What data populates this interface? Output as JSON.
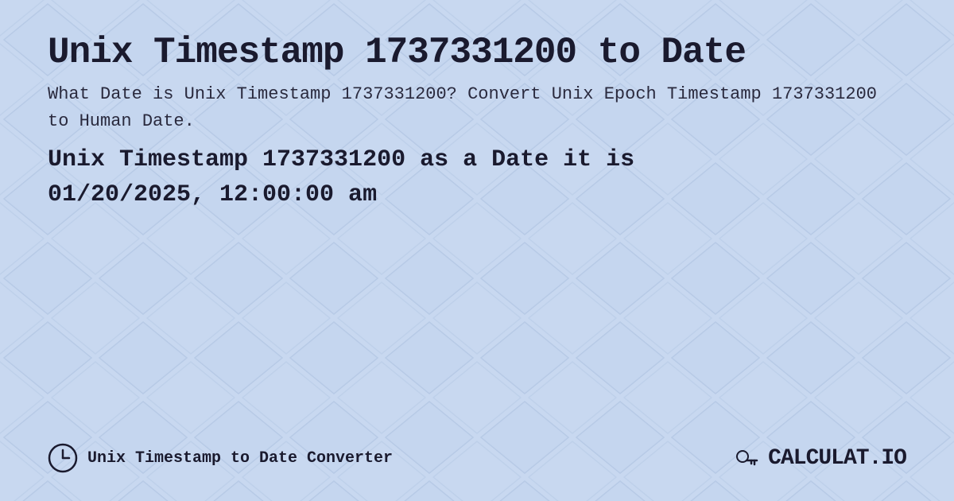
{
  "background": {
    "color": "#c8d8f0"
  },
  "header": {
    "title": "Unix Timestamp 1737331200 to Date"
  },
  "description": {
    "text": "What Date is Unix Timestamp 1737331200? Convert Unix Epoch Timestamp 1737331200 to Human Date."
  },
  "result": {
    "line1": "Unix Timestamp 1737331200 as a Date it is",
    "line2": "01/20/2025, 12:00:00 am"
  },
  "footer": {
    "converter_label": "Unix Timestamp to Date Converter",
    "logo_text": "CALCULAT.IO"
  }
}
